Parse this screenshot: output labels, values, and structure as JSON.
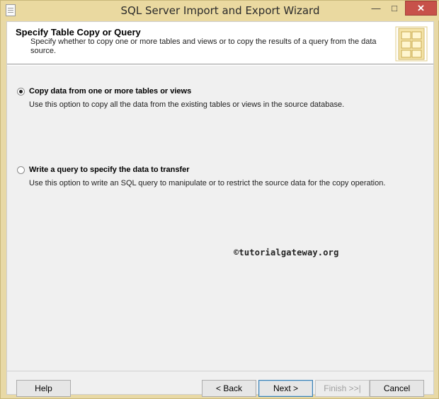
{
  "window": {
    "title": "SQL Server Import and Export Wizard",
    "minimize_glyph": "—",
    "maximize_glyph": "□",
    "close_glyph": "✕"
  },
  "header": {
    "title": "Specify Table Copy or Query",
    "description": "Specify whether to copy one or more tables and views or to copy the results of a query from the data source."
  },
  "options": [
    {
      "label": "Copy data from one or more tables or views",
      "description": "Use this option to copy all the data from the existing tables or views in the source database.",
      "selected": true
    },
    {
      "label": "Write a query to specify the data to transfer",
      "description": "Use this option to write an SQL query to manipulate or to restrict the source data for the copy operation.",
      "selected": false
    }
  ],
  "watermark": "©tutorialgateway.org",
  "buttons": {
    "help": "Help",
    "back": "< Back",
    "next": "Next >",
    "finish": "Finish >>|",
    "cancel": "Cancel"
  },
  "colors": {
    "title_bar": "#ead9a0",
    "close_button": "#c7514a",
    "dialog_background": "#f0f0f0",
    "header_background": "#ffffff"
  }
}
